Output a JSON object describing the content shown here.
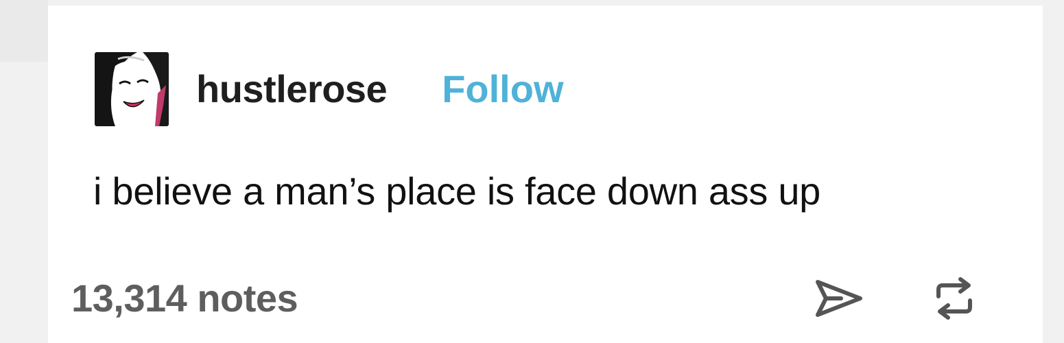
{
  "post": {
    "username": "hustlerose",
    "follow_label": "Follow",
    "body": "i believe a man’s place is face down ass up",
    "notes_label": "13,314 notes"
  },
  "icons": {
    "avatar": "avatar-image",
    "share": "share-icon",
    "reblog": "reblog-icon"
  },
  "colors": {
    "follow": "#4fb2d8",
    "username": "#1f1f1f",
    "notes": "#5e5e5e",
    "icon": "#555555"
  }
}
